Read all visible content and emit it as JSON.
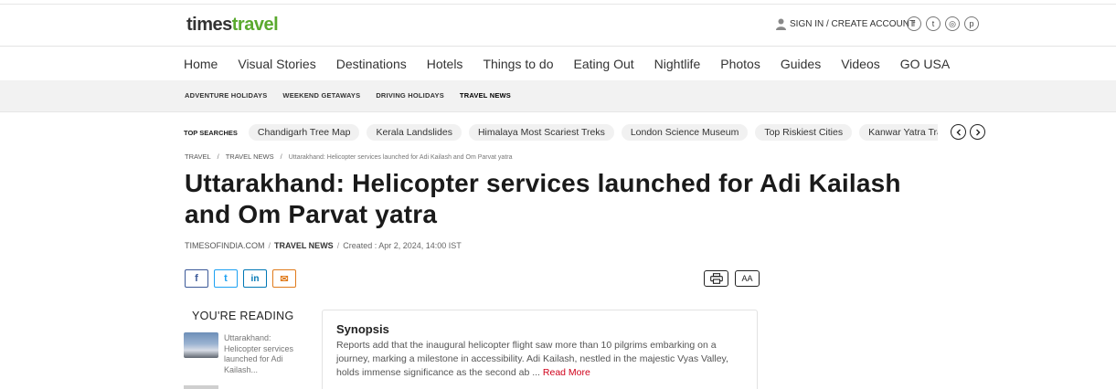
{
  "header": {
    "logo_part1": "times",
    "logo_part2": "travel",
    "signin_text": "SIGN IN / CREATE ACCOUNT",
    "socials": [
      "f",
      "t",
      "◎",
      "p"
    ]
  },
  "main_nav": [
    "Home",
    "Visual Stories",
    "Destinations",
    "Hotels",
    "Things to do",
    "Eating Out",
    "Nightlife",
    "Photos",
    "Guides",
    "Videos",
    "GO USA"
  ],
  "sub_nav": [
    "ADVENTURE HOLIDAYS",
    "WEEKEND GETAWAYS",
    "DRIVING HOLIDAYS",
    "TRAVEL NEWS"
  ],
  "top_searches": {
    "label": "TOP SEARCHES",
    "chips": [
      "Chandigarh Tree Map",
      "Kerala Landslides",
      "Himalaya Most Scariest Treks",
      "London Science Museum",
      "Top Riskiest Cities",
      "Kanwar Yatra Traffic Advisory"
    ]
  },
  "breadcrumb": {
    "item1": "TRAVEL",
    "item2": "TRAVEL NEWS",
    "current": "Uttarakhand: Helicopter services launched for Adi Kailash and Om Parvat yatra"
  },
  "article": {
    "title": "Uttarakhand: Helicopter services launched for Adi Kailash and Om Parvat yatra",
    "source": "TIMESOFINDIA.COM",
    "category": "TRAVEL NEWS",
    "created": "Created : Apr 2, 2024, 14:00 IST"
  },
  "share": {
    "facebook": "f",
    "twitter": "t",
    "linkedin": "in",
    "email": "✉"
  },
  "tools": {
    "font_size": "AA"
  },
  "reading": {
    "label": "YOU'RE READING",
    "item_text": "Uttarakhand: Helicopter services launched for Adi Kailash..."
  },
  "synopsis": {
    "title": "Synopsis",
    "text": "Reports add that the inaugural helicopter flight saw more than 10 pilgrims embarking on a journey, marking a milestone in accessibility. Adi Kailash, nestled in the majestic Vyas Valley, holds immense significance as the second ab",
    "ellipsis": " ...",
    "read_more": "Read More"
  },
  "colors": {
    "brand_green": "#5aa92e",
    "read_more": "#d0021b"
  }
}
